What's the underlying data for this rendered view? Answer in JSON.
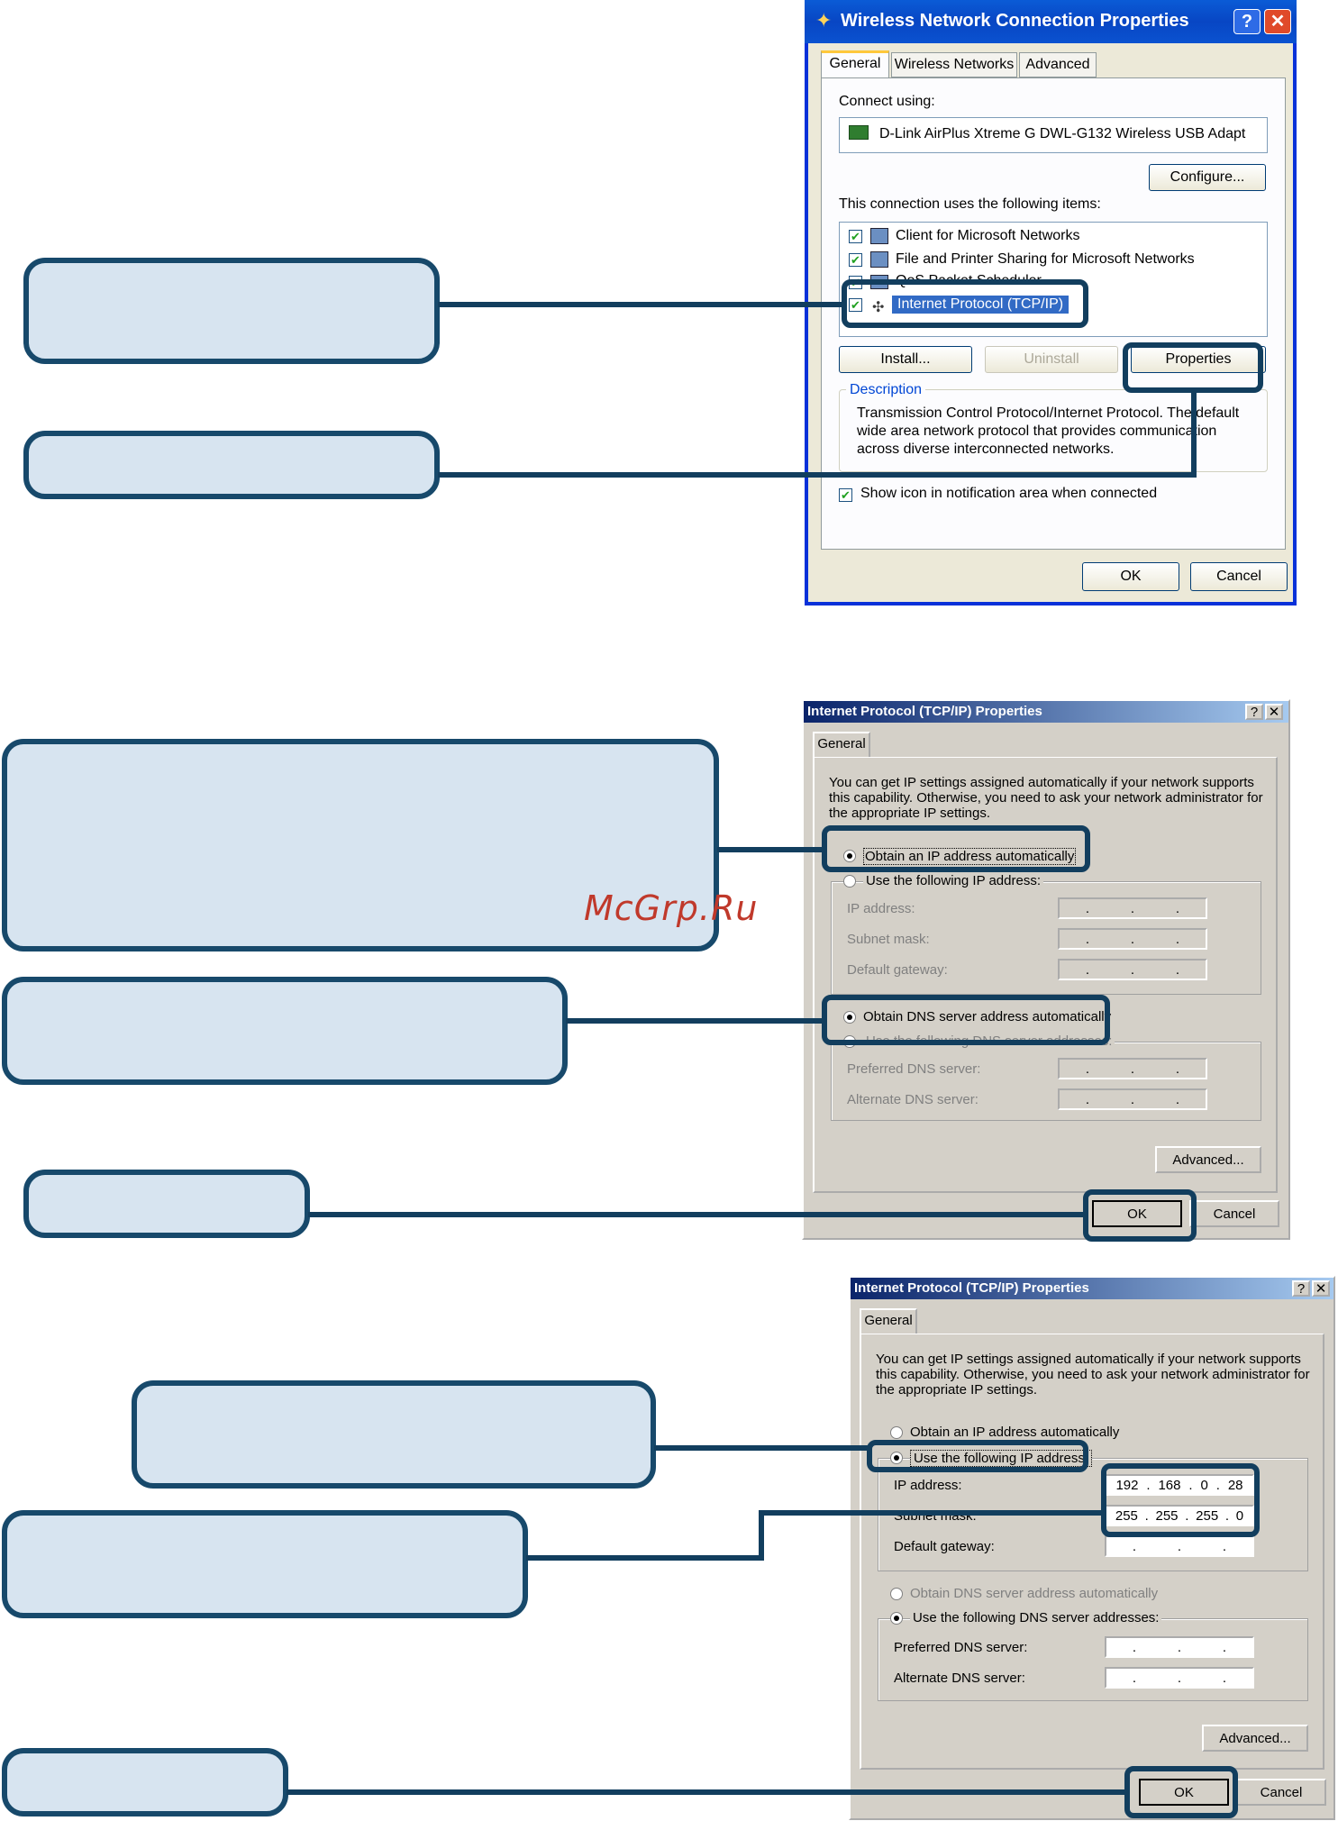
{
  "dlg1": {
    "title": "Wireless Network Connection Properties",
    "tabs": [
      "General",
      "Wireless Networks",
      "Advanced"
    ],
    "connect_using_label": "Connect using:",
    "adapter": "D-Link AirPlus Xtreme G DWL-G132 Wireless USB Adapt",
    "configure": "Configure...",
    "items_label": "This connection uses the following items:",
    "items": [
      "Client for Microsoft Networks",
      "File and Printer Sharing for Microsoft Networks",
      "QoS Packet Scheduler",
      "Internet Protocol (TCP/IP)"
    ],
    "install": "Install...",
    "uninstall": "Uninstall",
    "properties": "Properties",
    "description_label": "Description",
    "description": [
      "Transmission Control Protocol/Internet Protocol. The default",
      "wide area network protocol that provides communication",
      "across diverse interconnected networks."
    ],
    "show_icon": "Show icon in notification area when connected",
    "ok": "OK",
    "cancel": "Cancel"
  },
  "dlg2": {
    "title": "Internet Protocol (TCP/IP) Properties",
    "tab": "General",
    "intro": [
      "You can get IP settings assigned automatically if your network supports",
      "this capability. Otherwise, you need to ask your network administrator for",
      "the appropriate IP settings."
    ],
    "obtain_ip": "Obtain an IP address automatically",
    "use_ip": "Use the following IP address:",
    "ip_label": "IP address:",
    "subnet_label": "Subnet mask:",
    "gateway_label": "Default gateway:",
    "obtain_dns": "Obtain DNS server address automatically",
    "use_dns": "Use the following DNS server addresses:",
    "pref_dns": "Preferred DNS server:",
    "alt_dns": "Alternate DNS server:",
    "advanced": "Advanced...",
    "ok": "OK",
    "cancel": "Cancel"
  },
  "dlg3": {
    "title": "Internet Protocol (TCP/IP) Properties",
    "tab": "General",
    "intro": [
      "You can get IP settings assigned automatically if your network supports",
      "this capability. Otherwise, you need to ask your network administrator for",
      "the appropriate IP settings."
    ],
    "obtain_ip": "Obtain an IP address automatically",
    "use_ip": "Use the following IP address:",
    "ip_label": "IP address:",
    "ip_value": [
      "192",
      "168",
      "0",
      "28"
    ],
    "subnet_label": "Subnet mask:",
    "subnet_value": [
      "255",
      "255",
      "255",
      "0"
    ],
    "gateway_label": "Default gateway:",
    "obtain_dns": "Obtain DNS server address automatically",
    "use_dns": "Use the following DNS server addresses:",
    "pref_dns": "Preferred DNS server:",
    "alt_dns": "Alternate DNS server:",
    "advanced": "Advanced...",
    "ok": "OK",
    "cancel": "Cancel"
  },
  "watermark": "McGrp.Ru",
  "colors": {
    "callout_fill": "#d7e4f0",
    "callout_border": "#17496b",
    "xp_title": "#0a5bd6",
    "classic_title": "#0a246a"
  }
}
